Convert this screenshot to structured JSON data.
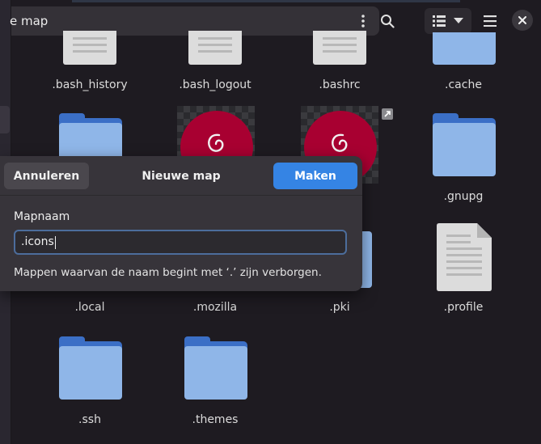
{
  "header": {
    "path_title": "e map",
    "icons": {
      "path_menu": "vertical-dots-icon",
      "search": "search-icon",
      "view": "list-view-icon",
      "view_dropdown": "chevron-down-icon",
      "menu": "hamburger-menu-icon",
      "close": "close-icon"
    }
  },
  "files": {
    "row1": [
      ".bash_history",
      ".bash_logout",
      ".bashrc",
      ".cache"
    ],
    "row2_right": ".gnupg",
    "row3": [
      ".local",
      ".mozilla",
      ".pki",
      ".profile"
    ],
    "row4": [
      ".ssh",
      ".themes"
    ]
  },
  "dialog": {
    "cancel_label": "Annuleren",
    "title": "Nieuwe map",
    "create_label": "Maken",
    "field_label": "Mapnaam",
    "field_value": ".icons",
    "hint": "Mappen waarvan de naam begint met ‘.’ zijn verborgen."
  },
  "colors": {
    "accent": "#3584e4",
    "folder": "#8fb6e8",
    "debian_red": "#a80031"
  }
}
